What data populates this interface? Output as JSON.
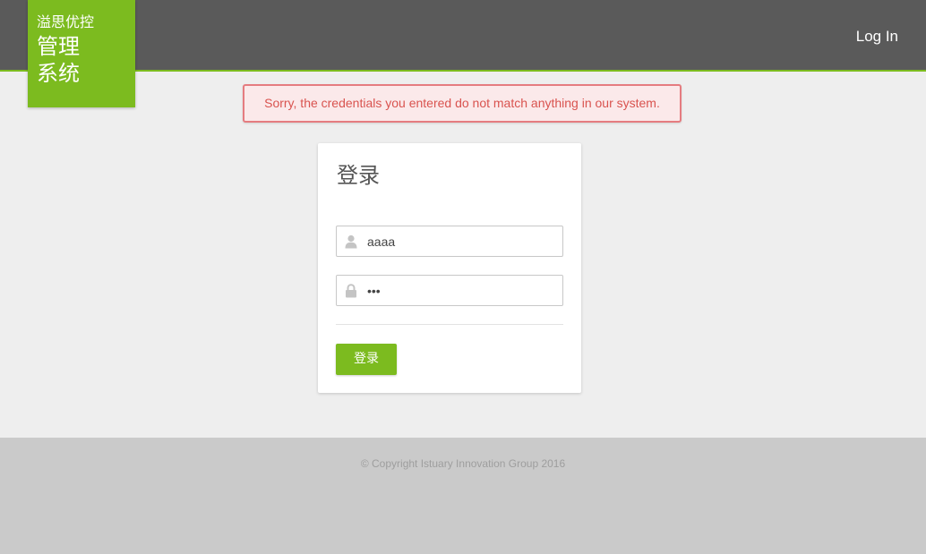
{
  "header": {
    "brand_small": "溢思优控",
    "brand_line1": "管理",
    "brand_line2": "系统",
    "login_link": "Log In"
  },
  "alert": {
    "message": "Sorry, the credentials you entered do not match anything in our system."
  },
  "login_form": {
    "title": "登录",
    "username_value": "aaaa",
    "password_value": "•••",
    "submit_label": "登录"
  },
  "footer": {
    "copyright": "© Copyright Istuary Innovation Group 2016"
  },
  "colors": {
    "accent": "#7cbb1f",
    "topbar": "#5a5a5a",
    "alert_text": "#d9534f",
    "alert_border": "#e57c80",
    "footer_bg": "#cacaca"
  },
  "icons": {
    "username": "user-icon",
    "password": "lock-icon"
  }
}
